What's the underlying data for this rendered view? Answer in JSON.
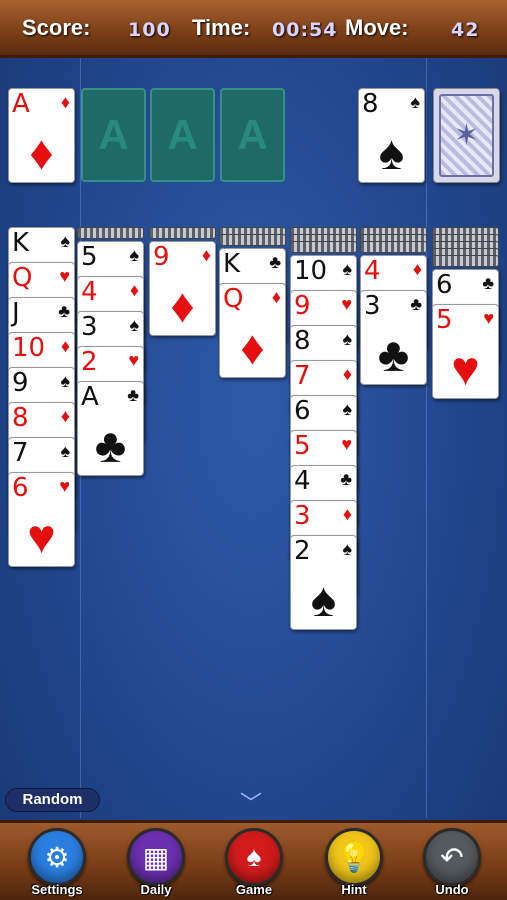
{
  "header": {
    "score_label": "Score:",
    "score": "100",
    "time_label": "Time:",
    "time": "00:54",
    "move_label": "Move:",
    "move": "42"
  },
  "foundations": [
    {
      "rank": "A",
      "suit": "♦",
      "color": "red"
    },
    {
      "placeholder": "A"
    },
    {
      "placeholder": "A"
    },
    {
      "placeholder": "A"
    }
  ],
  "waste": {
    "rank": "8",
    "suit": "♠",
    "color": "blk"
  },
  "tableau": [
    {
      "hidden": 0,
      "cards": [
        [
          "K",
          "♠"
        ],
        [
          "Q",
          "♥"
        ],
        [
          "J",
          "♣"
        ],
        [
          "10",
          "♦"
        ],
        [
          "9",
          "♠"
        ],
        [
          "8",
          "♦"
        ],
        [
          "7",
          "♠"
        ],
        [
          "6",
          "♥"
        ]
      ]
    },
    {
      "hidden": 1,
      "cards": [
        [
          "5",
          "♠"
        ],
        [
          "4",
          "♦"
        ],
        [
          "3",
          "♠"
        ],
        [
          "2",
          "♥"
        ],
        [
          "A",
          "♣"
        ]
      ]
    },
    {
      "hidden": 1,
      "cards": [
        [
          "9",
          "♦"
        ]
      ]
    },
    {
      "hidden": 2,
      "cards": [
        [
          "K",
          "♣"
        ],
        [
          "Q",
          "♦"
        ]
      ]
    },
    {
      "hidden": 3,
      "cards": [
        [
          "10",
          "♠"
        ],
        [
          "9",
          "♥"
        ],
        [
          "8",
          "♠"
        ],
        [
          "7",
          "♦"
        ],
        [
          "6",
          "♠"
        ],
        [
          "5",
          "♥"
        ],
        [
          "4",
          "♣"
        ],
        [
          "3",
          "♦"
        ],
        [
          "2",
          "♠"
        ]
      ]
    },
    {
      "hidden": 3,
      "cards": [
        [
          "4",
          "♦"
        ],
        [
          "3",
          "♣"
        ]
      ]
    },
    {
      "hidden": 5,
      "cards": [
        [
          "6",
          "♣"
        ],
        [
          "5",
          "♥"
        ]
      ]
    }
  ],
  "random_label": "Random",
  "toolbar": [
    {
      "label": "Settings",
      "icon": "gear-icon",
      "glyph": "⚙",
      "color": "#2a7ee0"
    },
    {
      "label": "Daily",
      "icon": "calendar-icon",
      "glyph": "▦",
      "color": "#6b2fb0"
    },
    {
      "label": "Game",
      "icon": "spade-icon",
      "glyph": "♠",
      "color": "#d11b1b"
    },
    {
      "label": "Hint",
      "icon": "lightbulb-icon",
      "glyph": "💡",
      "color": "#f0c419"
    },
    {
      "label": "Undo",
      "icon": "undo-icon",
      "glyph": "↶",
      "color": "#555a60"
    }
  ]
}
